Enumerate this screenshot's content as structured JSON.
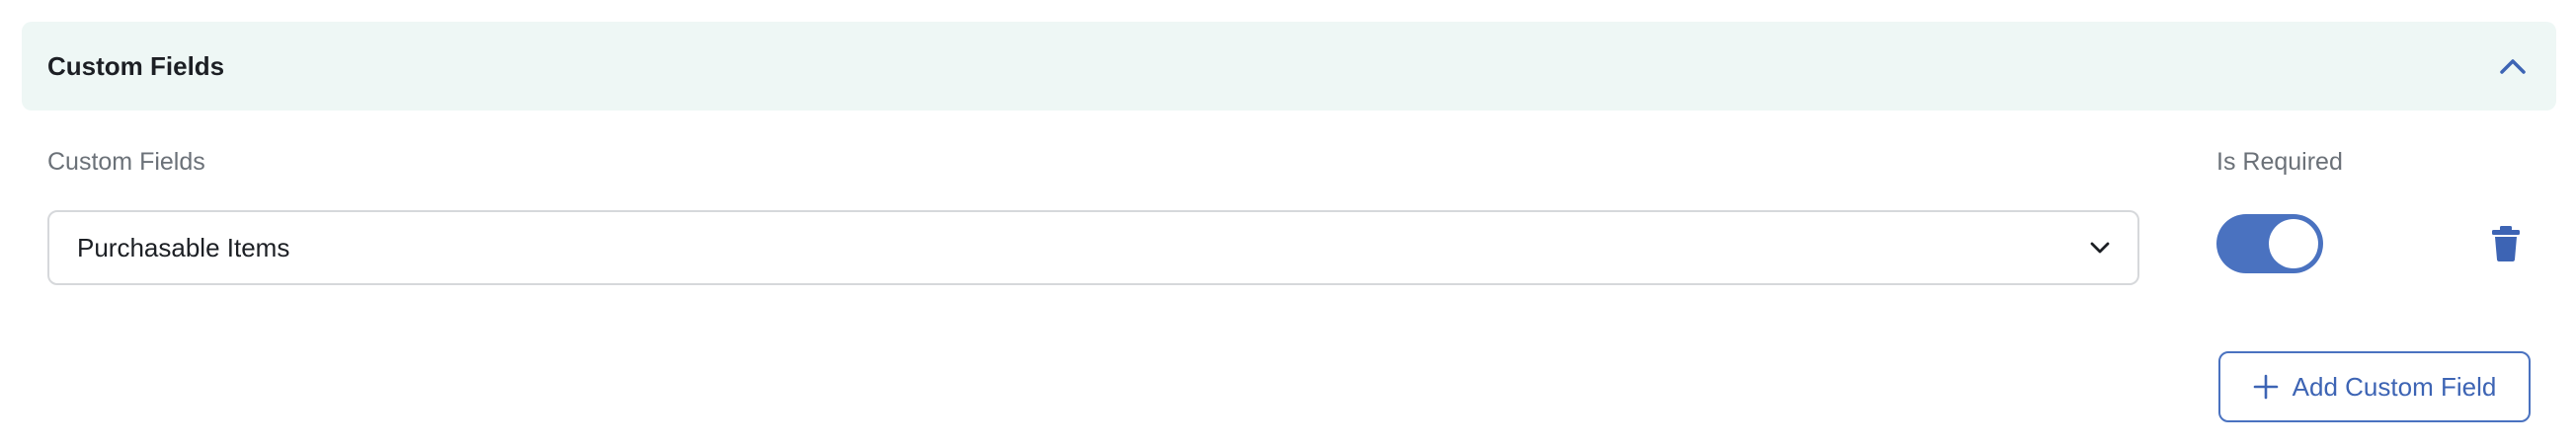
{
  "section": {
    "title": "Custom Fields",
    "collapse_icon": "chevron-up-icon"
  },
  "columns": {
    "custom_fields_label": "Custom Fields",
    "is_required_label": "Is Required"
  },
  "field_row": {
    "selected_value": "Purchasable Items",
    "dropdown_icon": "chevron-down-icon",
    "is_required": true,
    "delete_icon": "trash-icon"
  },
  "actions": {
    "add_label": "Add Custom Field",
    "add_icon": "plus-icon"
  },
  "colors": {
    "accent": "#4a72c0",
    "header_bg": "#eef7f5",
    "label_gray": "#6b7178"
  }
}
